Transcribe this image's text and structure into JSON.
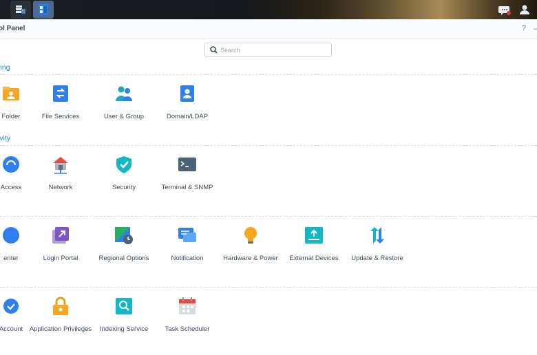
{
  "window": {
    "title": "ol Panel",
    "help": "?",
    "minimize": "–"
  },
  "search": {
    "placeholder": "Search",
    "value": ""
  },
  "sections": [
    {
      "title": "ring",
      "items": [
        {
          "label": "Folder",
          "icon": "shared-folder-icon"
        },
        {
          "label": "File Services",
          "icon": "file-services-icon"
        },
        {
          "label": "User & Group",
          "icon": "user-group-icon"
        },
        {
          "label": "Domain/LDAP",
          "icon": "domain-ldap-icon"
        }
      ]
    },
    {
      "title": "ivity",
      "items": [
        {
          "label": "Access",
          "icon": "external-access-icon"
        },
        {
          "label": "Network",
          "icon": "network-icon"
        },
        {
          "label": "Security",
          "icon": "security-shield-icon"
        },
        {
          "label": "Terminal & SNMP",
          "icon": "terminal-icon"
        }
      ]
    },
    {
      "title": "",
      "items": [
        {
          "label": "enter",
          "icon": "info-center-icon"
        },
        {
          "label": "Login Portal",
          "icon": "login-portal-icon"
        },
        {
          "label": "Regional Options",
          "icon": "regional-options-icon"
        },
        {
          "label": "Notification",
          "icon": "notification-icon"
        },
        {
          "label": "Hardware & Power",
          "icon": "hardware-power-icon"
        },
        {
          "label": "External Devices",
          "icon": "external-devices-icon"
        },
        {
          "label": "Update & Restore",
          "icon": "update-restore-icon"
        }
      ]
    },
    {
      "title": "",
      "items": [
        {
          "label": "Account",
          "icon": "account-icon"
        },
        {
          "label": "Application Privileges",
          "icon": "application-privileges-icon"
        },
        {
          "label": "Indexing Service",
          "icon": "indexing-service-icon"
        },
        {
          "label": "Task Scheduler",
          "icon": "task-scheduler-icon"
        }
      ]
    }
  ],
  "colors": {
    "accent": "#1e88e5",
    "background": "#ffffff",
    "taskbar": "#1b1f24"
  }
}
